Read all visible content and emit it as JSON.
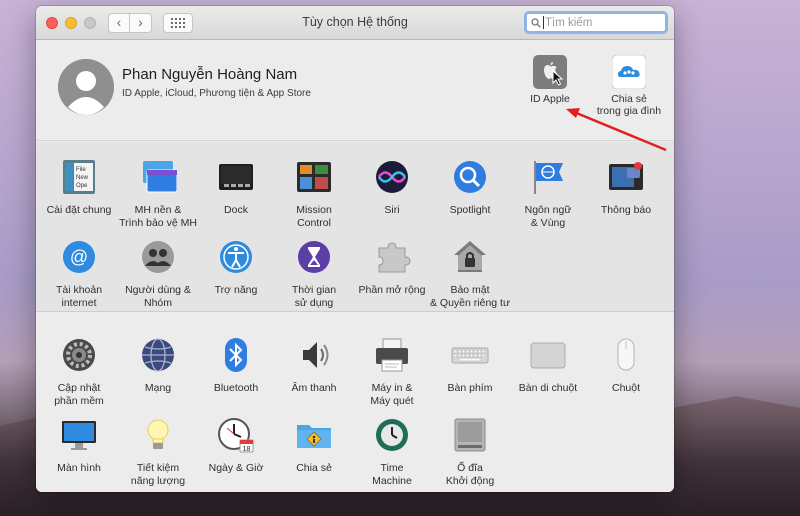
{
  "window": {
    "title": "Tùy chọn Hệ thống"
  },
  "search": {
    "placeholder": "Tìm kiếm"
  },
  "account": {
    "name": "Phan Nguyễn Hoàng Nam",
    "subtitle": "ID Apple, iCloud, Phương tiện & App Store",
    "apple_id": {
      "label": "ID Apple",
      "icon": "apple-logo-icon"
    },
    "family": {
      "label_line1": "Chia sẻ",
      "label_line2": "trong gia đình",
      "icon": "family-cloud-icon"
    }
  },
  "section1": {
    "row1": [
      {
        "name": "general",
        "line1": "Cài đặt chung",
        "line2": "",
        "icon": "general-icon"
      },
      {
        "name": "desktop",
        "line1": "MH nền &",
        "line2": "Trình bảo vệ MH",
        "icon": "desktop-screensaver-icon"
      },
      {
        "name": "dock",
        "line1": "Dock",
        "line2": "",
        "icon": "dock-icon"
      },
      {
        "name": "mission-control",
        "line1": "Mission",
        "line2": "Control",
        "icon": "mission-control-icon"
      },
      {
        "name": "siri",
        "line1": "Siri",
        "line2": "",
        "icon": "siri-icon"
      },
      {
        "name": "spotlight",
        "line1": "Spotlight",
        "line2": "",
        "icon": "spotlight-icon"
      },
      {
        "name": "language",
        "line1": "Ngôn ngữ",
        "line2": "& Vùng",
        "icon": "language-flag-icon"
      },
      {
        "name": "notifications",
        "line1": "Thông báo",
        "line2": "",
        "icon": "notifications-icon"
      }
    ],
    "row2": [
      {
        "name": "internet-accounts",
        "line1": "Tài khoản",
        "line2": "internet",
        "icon": "at-sign-icon"
      },
      {
        "name": "users-groups",
        "line1": "Người dùng &",
        "line2": "Nhóm",
        "icon": "users-icon"
      },
      {
        "name": "accessibility",
        "line1": "Trợ năng",
        "line2": "",
        "icon": "accessibility-icon"
      },
      {
        "name": "screen-time",
        "line1": "Thời gian",
        "line2": "sử dụng",
        "icon": "hourglass-icon"
      },
      {
        "name": "extensions",
        "line1": "Phần mở rộng",
        "line2": "",
        "icon": "puzzle-icon"
      },
      {
        "name": "security",
        "line1": "Bảo mật",
        "line2": "& Quyền riêng tư",
        "icon": "house-lock-icon"
      }
    ]
  },
  "section2": {
    "row1": [
      {
        "name": "software-update",
        "line1": "Cập nhật",
        "line2": "phần mềm",
        "icon": "gear-icon"
      },
      {
        "name": "network",
        "line1": "Mạng",
        "line2": "",
        "icon": "globe-icon"
      },
      {
        "name": "bluetooth",
        "line1": "Bluetooth",
        "line2": "",
        "icon": "bluetooth-icon"
      },
      {
        "name": "sound",
        "line1": "Âm thanh",
        "line2": "",
        "icon": "speaker-icon"
      },
      {
        "name": "printers",
        "line1": "Máy in &",
        "line2": "Máy quét",
        "icon": "printer-icon"
      },
      {
        "name": "keyboard",
        "line1": "Bàn phím",
        "line2": "",
        "icon": "keyboard-icon"
      },
      {
        "name": "trackpad",
        "line1": "Bàn di chuột",
        "line2": "",
        "icon": "trackpad-icon"
      },
      {
        "name": "mouse",
        "line1": "Chuột",
        "line2": "",
        "icon": "mouse-icon"
      }
    ],
    "row2": [
      {
        "name": "displays",
        "line1": "Màn hình",
        "line2": "",
        "icon": "display-icon"
      },
      {
        "name": "energy",
        "line1": "Tiết kiệm",
        "line2": "năng lượng",
        "icon": "lightbulb-icon"
      },
      {
        "name": "date-time",
        "line1": "Ngày & Giờ",
        "line2": "",
        "icon": "clock-calendar-icon"
      },
      {
        "name": "sharing",
        "line1": "Chia sẻ",
        "line2": "",
        "icon": "sharing-folder-icon"
      },
      {
        "name": "time-machine",
        "line1": "Time",
        "line2": "Machine",
        "icon": "time-machine-icon"
      },
      {
        "name": "startup-disk",
        "line1": "Ổ đĩa",
        "line2": "Khởi động",
        "icon": "hard-disk-icon"
      }
    ]
  },
  "colors": {
    "annotation_arrow": "#e02020",
    "search_focus": "#8fb4e6",
    "accent_blue": "#2f7de1"
  }
}
